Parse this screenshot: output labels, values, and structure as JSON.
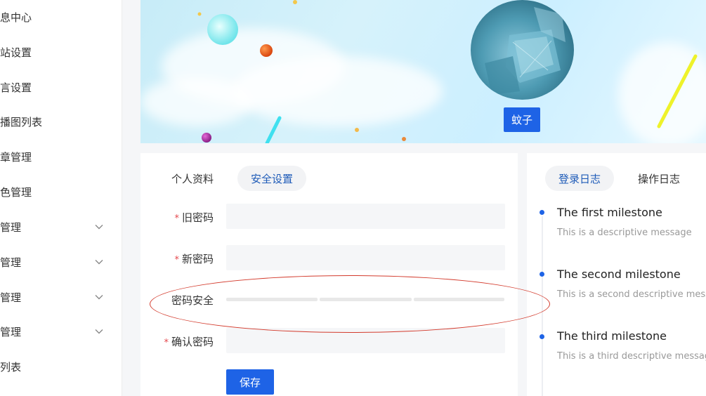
{
  "sidebar": {
    "items": [
      {
        "label": "消息中心",
        "has_chevron": false
      },
      {
        "label": "网站设置",
        "has_chevron": false
      },
      {
        "label": "语言设置",
        "has_chevron": false
      },
      {
        "label": "轮播图列表",
        "has_chevron": false
      },
      {
        "label": "文章管理",
        "has_chevron": false
      },
      {
        "label": "角色管理",
        "has_chevron": false
      },
      {
        "label": "管理",
        "has_chevron": true
      },
      {
        "label": "管理",
        "has_chevron": true
      },
      {
        "label": "管理",
        "has_chevron": true
      },
      {
        "label": "管理",
        "has_chevron": true
      },
      {
        "label": "列表",
        "has_chevron": false
      }
    ]
  },
  "profile": {
    "name": "蚊子"
  },
  "settings": {
    "tabs": [
      {
        "label": "个人资料",
        "active": false
      },
      {
        "label": "安全设置",
        "active": true
      }
    ],
    "fields": {
      "old_password": {
        "label": "旧密码",
        "required": true,
        "value": ""
      },
      "new_password": {
        "label": "新密码",
        "required": true,
        "value": ""
      },
      "password_strength": {
        "label": "密码安全"
      },
      "confirm_password": {
        "label": "确认密码",
        "required": true,
        "value": ""
      }
    },
    "save_label": "保存"
  },
  "logs": {
    "tabs": [
      {
        "label": "登录日志",
        "active": true
      },
      {
        "label": "操作日志",
        "active": false
      }
    ],
    "timeline": [
      {
        "title": "The first milestone",
        "desc": "This is a descriptive message"
      },
      {
        "title": "The second milestone",
        "desc": "This is a second descriptive message"
      },
      {
        "title": "The third milestone",
        "desc": "This is a third descriptive message"
      }
    ]
  },
  "colors": {
    "primary": "#1e63e6",
    "required": "#e5484d",
    "annotation": "#d33a2c"
  }
}
